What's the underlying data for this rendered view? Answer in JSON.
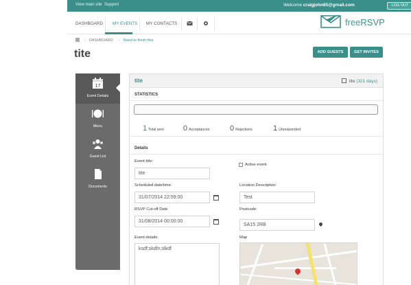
{
  "topbar": {
    "links": [
      "View main site",
      "Support"
    ],
    "welcome_prefix": "Welcome",
    "username": "craigjohn85@gmail.com",
    "logout_label": "LOG OUT"
  },
  "nav": {
    "items": [
      "DASHBOARD",
      "MY EVENTS",
      "MY CONTACTS"
    ],
    "active": "MY EVENTS",
    "icons": [
      "mail-icon",
      "gear-icon"
    ]
  },
  "brand": {
    "name_prefix": "free",
    "name_suffix": "RSVP"
  },
  "breadcrumb": {
    "items": [
      "DASHBOARD",
      "Need to finish this"
    ]
  },
  "page": {
    "title": "tite"
  },
  "actions": {
    "add_guests": "ADD GUESTS",
    "get_invites": "GET INVITES"
  },
  "sidebar": {
    "items": [
      {
        "label": "Event Details",
        "icon": "calendar-icon",
        "badge": "17",
        "active": true
      },
      {
        "label": "Menu",
        "icon": "dinner-plate-icon",
        "active": false
      },
      {
        "label": "Guest List",
        "icon": "people-icon",
        "active": false
      },
      {
        "label": "Documents",
        "icon": "document-icon",
        "active": false
      }
    ]
  },
  "event": {
    "title": "tite",
    "meta_name": "tite",
    "meta_days": "(321 days)"
  },
  "statistics": {
    "heading": "STATISTICS",
    "progress": 0,
    "stats": [
      {
        "value": "1",
        "label": "Total sent"
      },
      {
        "value": "0",
        "label": "Acceptances"
      },
      {
        "value": "0",
        "label": "Rejections"
      },
      {
        "value": "1",
        "label": "Unresponded"
      }
    ]
  },
  "details": {
    "heading": "Details",
    "event_title_label": "Event title:",
    "event_title_value": "tite",
    "active_event_label": "Active event",
    "scheduled_label": "Scheduled date/time:",
    "scheduled_value": "31/07/2014 22:59:00",
    "location_label": "Location Description:",
    "location_value": "Test",
    "cutoff_label": "RSVP Cut-off Date",
    "cutoff_value": "31/08/2014 00:00:00",
    "postcode_label": "Postcode:",
    "postcode_value": "SA15 2RB",
    "event_details_label": "Event details:",
    "event_details_value": "ksdf;skdfn;slkdf",
    "map_label": "Map"
  },
  "colors": {
    "accent": "#3a8f8b",
    "sidebar": "#6b6b6b"
  }
}
